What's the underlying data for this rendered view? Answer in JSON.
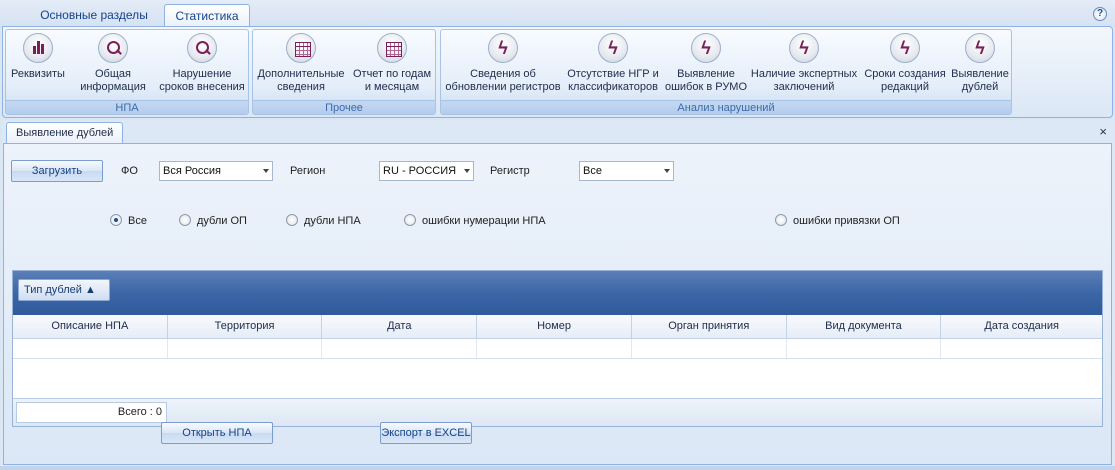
{
  "ribbon_tabs": [
    "Основные разделы",
    "Статистика"
  ],
  "help_label": "?",
  "ribbon_groups": [
    {
      "caption": "НПА",
      "buttons": [
        {
          "label": "Реквизиты",
          "icon": "bar-chart-icon"
        },
        {
          "label": "Общая\nинформация",
          "icon": "magnifier-icon"
        },
        {
          "label": "Нарушение\nсроков внесения",
          "icon": "magnifier-icon"
        }
      ]
    },
    {
      "caption": "Прочее",
      "buttons": [
        {
          "label": "Дополнительные\nсведения",
          "icon": "table-icon"
        },
        {
          "label": "Отчет по годам\nи месяцам",
          "icon": "table-icon"
        }
      ]
    },
    {
      "caption": "Анализ нарушений",
      "buttons": [
        {
          "label": "Сведения об\nобновлении регистров",
          "icon": "bolt-icon"
        },
        {
          "label": "Отсутствие НГР и\nклассификаторов",
          "icon": "bolt-icon"
        },
        {
          "label": "Выявление\nошибок в РУМО",
          "icon": "bolt-icon"
        },
        {
          "label": "Наличие экспертных\nзаключений",
          "icon": "bolt-icon"
        },
        {
          "label": "Сроки создания\nредакций",
          "icon": "bolt-icon"
        },
        {
          "label": "Выявление\nдублей",
          "icon": "bolt-icon"
        }
      ]
    }
  ],
  "document_tab": {
    "title": "Выявление дублей",
    "close": "×"
  },
  "filters": {
    "load_button": "Загрузить",
    "fo_label": "ФО",
    "fo_value": "Вся Россия",
    "region_label": "Регион",
    "region_value": "RU - РОССИЯ",
    "register_label": "Регистр",
    "register_value": "Все"
  },
  "radio_options": [
    {
      "label": "Все",
      "selected": true
    },
    {
      "label": "дубли ОП",
      "selected": false
    },
    {
      "label": "дубли НПА",
      "selected": false
    },
    {
      "label": "ошибки нумерации НПА",
      "selected": false
    },
    {
      "label": "ошибки привязки ОП",
      "selected": false
    }
  ],
  "grid": {
    "group_by": "Тип дублей ▲",
    "columns": [
      "Описание НПА",
      "Территория",
      "Дата",
      "Номер",
      "Орган принятия",
      "Вид документа",
      "Дата создания"
    ],
    "total": "Всего : 0"
  },
  "actions": {
    "open_button": "Открыть НПА",
    "export_button": "Экспорт в EXCEL"
  },
  "colors": {
    "accent": "#15428b",
    "ribbon_border": "#8db2e3",
    "icon_color": "#7a1f58",
    "group_bar": "#3c66a6"
  }
}
